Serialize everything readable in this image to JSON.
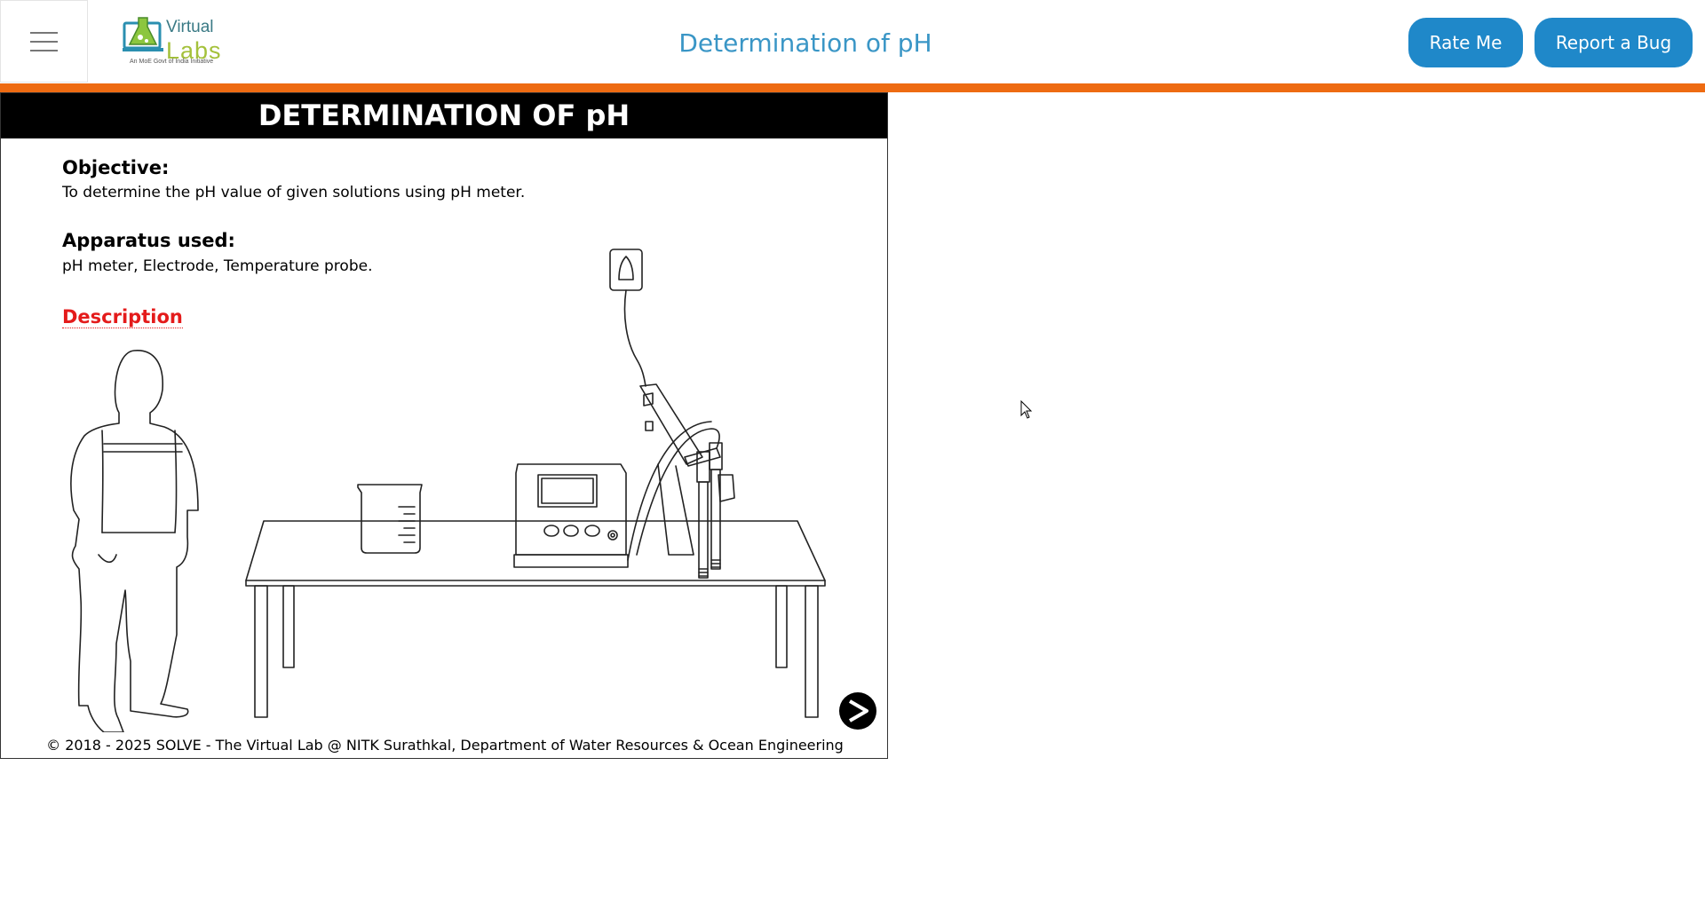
{
  "header": {
    "logo": {
      "word1": "Virtual",
      "word2": "Labs",
      "tagline": "An MoE Govt of India Initiative"
    },
    "title": "Determination of pH",
    "rate_label": "Rate Me",
    "bug_label": "Report a Bug",
    "accent_color": "#ee6b12",
    "button_color": "#1f88c9"
  },
  "lab": {
    "title": "DETERMINATION OF pH",
    "objective_heading": "Objective:",
    "objective_text": "To determine the pH value of given solutions using pH meter.",
    "apparatus_heading": "Apparatus used:",
    "apparatus_text": "pH meter, Electrode, Temperature probe.",
    "description_link": "Description",
    "copyright": "© 2018 - 2025 SOLVE - The Virtual Lab @ NITK Surathkal, Department of Water Resources & Ocean Engineering",
    "next_icon": "arrow-right-icon"
  }
}
